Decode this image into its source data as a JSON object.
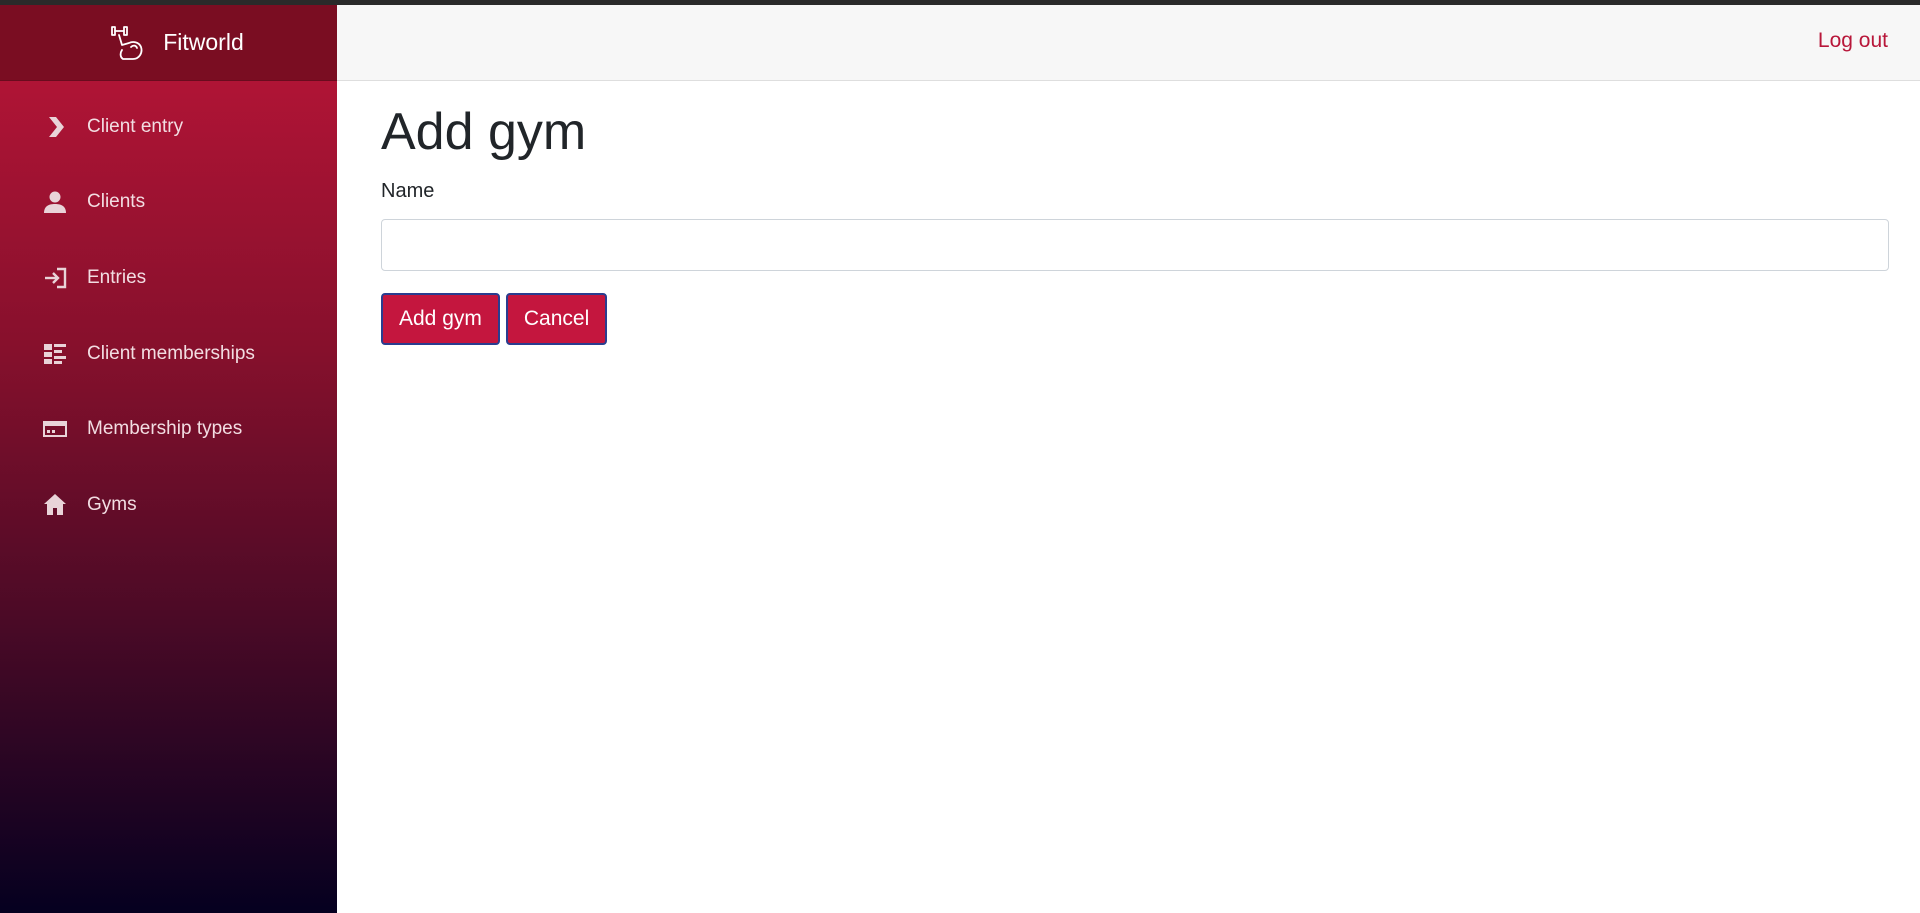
{
  "brand": {
    "name": "Fitworld",
    "logo_icon": "flexing-arm-icon"
  },
  "header": {
    "logout_label": "Log out"
  },
  "sidebar": {
    "items": [
      {
        "label": "Client entry",
        "icon": "chevron-right-icon"
      },
      {
        "label": "Clients",
        "icon": "person-icon"
      },
      {
        "label": "Entries",
        "icon": "login-icon"
      },
      {
        "label": "Client memberships",
        "icon": "dashboard-list-icon"
      },
      {
        "label": "Membership types",
        "icon": "card-icon"
      },
      {
        "label": "Gyms",
        "icon": "home-icon"
      }
    ]
  },
  "form": {
    "title": "Add gym",
    "name_label": "Name",
    "name_value": "",
    "submit_label": "Add gym",
    "cancel_label": "Cancel"
  },
  "colors": {
    "accent": "#c4163e",
    "sidebar_top": "#bb1538",
    "sidebar_bottom": "#050020",
    "link": "#b8173a"
  }
}
